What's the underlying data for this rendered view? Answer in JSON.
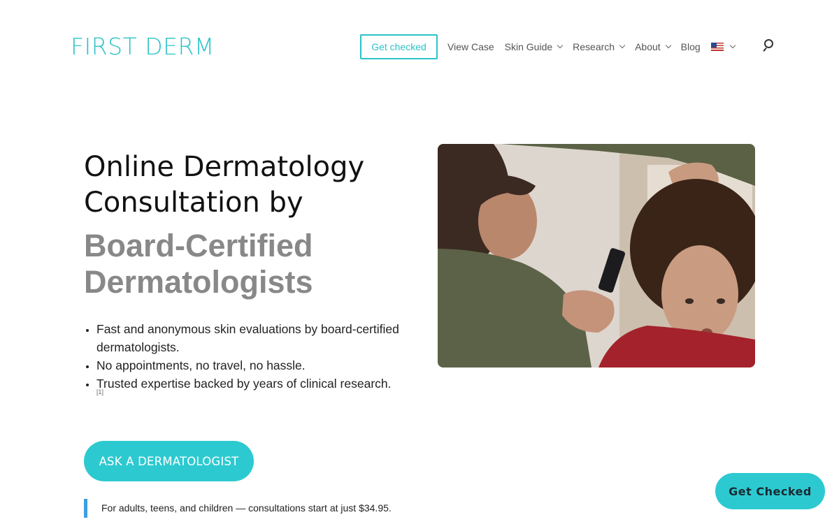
{
  "brand": {
    "logo_text": "FIRST DERM",
    "accent_color": "#2cc3c8"
  },
  "nav": {
    "cta_label": "Get checked",
    "items": [
      {
        "label": "View Case",
        "has_dropdown": false
      },
      {
        "label": "Skin Guide",
        "has_dropdown": true
      },
      {
        "label": "Research",
        "has_dropdown": true
      },
      {
        "label": "About",
        "has_dropdown": true
      },
      {
        "label": "Blog",
        "has_dropdown": false
      }
    ],
    "language_icon": "us-flag-icon",
    "search_icon": "search-icon"
  },
  "hero": {
    "title": "Online Dermatology Consultation by",
    "subtitle": "Board-Certified Dermatologists",
    "bullets": [
      "Fast and anonymous skin evaluations by board-certified dermatologists.",
      "No appointments, no travel, no hassle.",
      "Trusted expertise backed by years of clinical research."
    ],
    "footnote": "[1]",
    "cta_label": "ASK A DERMATOLOGIST",
    "note": "For adults, teens, and children — consultations start at just $34.95."
  },
  "floating_button": {
    "label": "Get Checked"
  }
}
